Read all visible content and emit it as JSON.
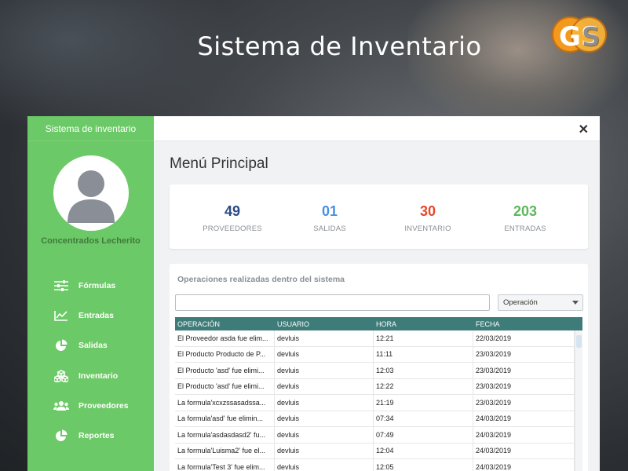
{
  "background": {
    "title": "Sistema de Inventario"
  },
  "window": {
    "sidebar_title": "Sistema de inventario",
    "company_name": "Concentrados Lecherito",
    "nav": [
      {
        "label": "Fórmulas",
        "icon": "sliders-icon"
      },
      {
        "label": "Entradas",
        "icon": "line-chart-icon"
      },
      {
        "label": "Salidas",
        "icon": "pie-chart-icon"
      },
      {
        "label": "Inventario",
        "icon": "cubes-icon"
      },
      {
        "label": "Proveedores",
        "icon": "users-icon"
      },
      {
        "label": "Reportes",
        "icon": "pie-chart-icon"
      }
    ],
    "close_label": "✕",
    "page_title": "Menú Principal",
    "stats": [
      {
        "value": "49",
        "label": "PROVEEDORES",
        "color": "#2b4a87"
      },
      {
        "value": "01",
        "label": "SALIDAS",
        "color": "#4a90e2"
      },
      {
        "value": "30",
        "label": "INVENTARIO",
        "color": "#e8472b"
      },
      {
        "value": "203",
        "label": "ENTRADAS",
        "color": "#5cb85c"
      }
    ],
    "operations": {
      "title": "Operaciones realizadas dentro del sistema",
      "search_value": "",
      "filter_selected": "Operación",
      "columns": [
        "OPERACIÓN",
        "USUARIO",
        "HORA",
        "FECHA"
      ],
      "rows": [
        [
          "El Proveedor asda fue elim...",
          "devluis",
          "12:21",
          "22/03/2019"
        ],
        [
          "El Producto Producto de P...",
          "devluis",
          "11:11",
          "23/03/2019"
        ],
        [
          "El Producto 'asd' fue elimi...",
          "devluis",
          "12:03",
          "23/03/2019"
        ],
        [
          "El Producto 'asd' fue elimi...",
          "devluis",
          "12:22",
          "23/03/2019"
        ],
        [
          "La formula'xcxzssasadssa...",
          "devluis",
          "21:19",
          "23/03/2019"
        ],
        [
          "La formula'asd' fue elimin...",
          "devluis",
          "07:34",
          "24/03/2019"
        ],
        [
          "La formula'asdasdasd2' fu...",
          "devluis",
          "07:49",
          "24/03/2019"
        ],
        [
          "La formula'Luisma2' fue el...",
          "devluis",
          "12:04",
          "24/03/2019"
        ],
        [
          "La formula'Test 3' fue elim...",
          "devluis",
          "12:05",
          "24/03/2019"
        ]
      ]
    }
  }
}
